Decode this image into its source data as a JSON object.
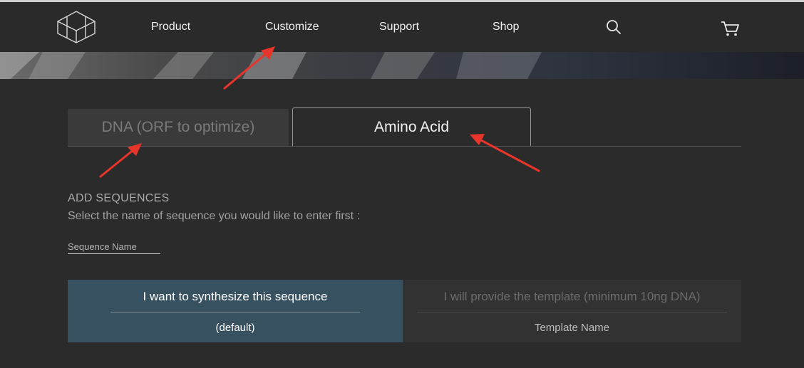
{
  "nav": {
    "links": [
      "Product",
      "Customize",
      "Support",
      "Shop"
    ],
    "icons": [
      "logo-icon",
      "search-icon",
      "cart-icon"
    ]
  },
  "tabs": {
    "dna_label": "DNA (ORF to optimize)",
    "amino_label": "Amino Acid",
    "active": "Amino Acid"
  },
  "add_sequences": {
    "title": "ADD SEQUENCES",
    "subtitle": "Select the name of sequence you would like to enter first :",
    "sequence_name_placeholder": "Sequence Name"
  },
  "options": {
    "synthesize_label": "I want to synthesize this sequence",
    "synthesize_sub": "(default)",
    "template_label": "I will provide the template (minimum 10ng DNA)",
    "template_sub": "Template Name"
  },
  "colors": {
    "nav_bg": "#2a2a2a",
    "page_bg": "#2b2b2b",
    "selected_option_bg": "#385160",
    "annotation_arrow": "#e8352b"
  }
}
